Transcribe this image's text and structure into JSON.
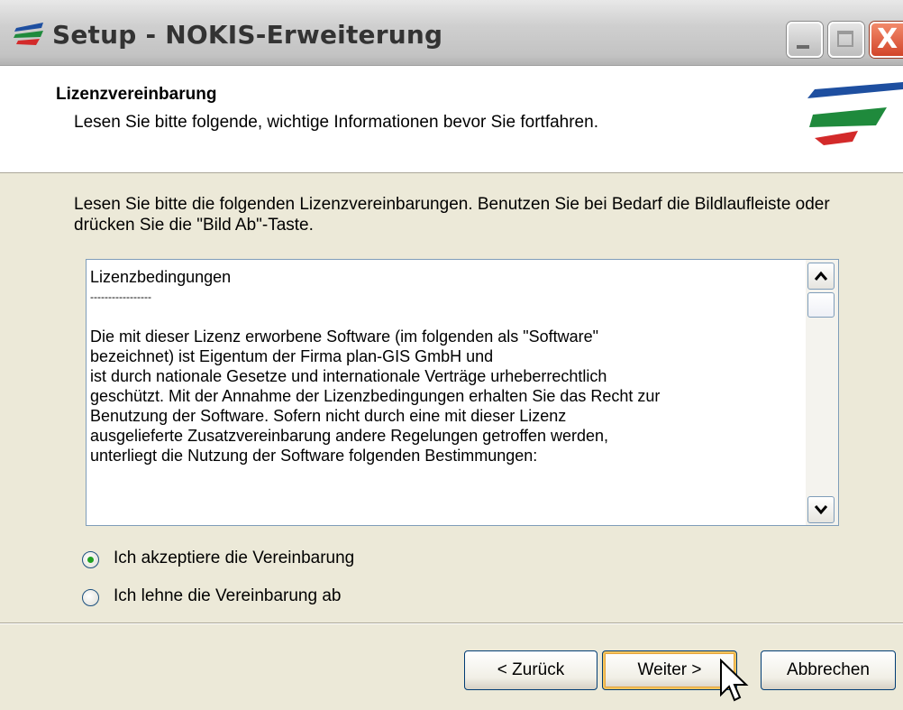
{
  "window": {
    "title": "Setup - NOKIS-Erweiterung",
    "close_glyph": "X"
  },
  "header": {
    "title": "Lizenzvereinbarung",
    "subtitle": "Lesen Sie bitte folgende, wichtige Informationen bevor Sie fortfahren."
  },
  "instructions": "Lesen Sie bitte die folgenden Lizenzvereinbarungen. Benutzen Sie bei Bedarf die Bildlaufleiste oder drücken Sie die \"Bild Ab\"-Taste.",
  "license": {
    "lines": [
      "Lizenzbedingungen",
      "-----------------",
      "",
      "Die mit dieser Lizenz erworbene Software (im folgenden als \"Software\"",
      "bezeichnet) ist Eigentum der Firma plan-GIS GmbH und",
      "ist durch nationale Gesetze und internationale Verträge urheberrechtlich",
      "geschützt. Mit der Annahme der Lizenzbedingungen erhalten Sie das Recht zur",
      "Benutzung der Software. Sofern nicht durch eine mit dieser Lizenz",
      "ausgelieferte Zusatzvereinbarung andere Regelungen getroffen werden,",
      "unterliegt die Nutzung der Software folgenden Bestimmungen:"
    ]
  },
  "options": {
    "accept": {
      "label": "Ich akzeptiere die Vereinbarung",
      "selected": true
    },
    "decline": {
      "label": "Ich lehne die Vereinbarung ab",
      "selected": false
    }
  },
  "buttons": {
    "back": "< Zurück",
    "next": "Weiter >",
    "cancel": "Abbrechen"
  },
  "colors": {
    "dialog_bg": "#ece9d8",
    "radio_dot": "#21a121",
    "default_button_focus": "#f4c55e"
  }
}
